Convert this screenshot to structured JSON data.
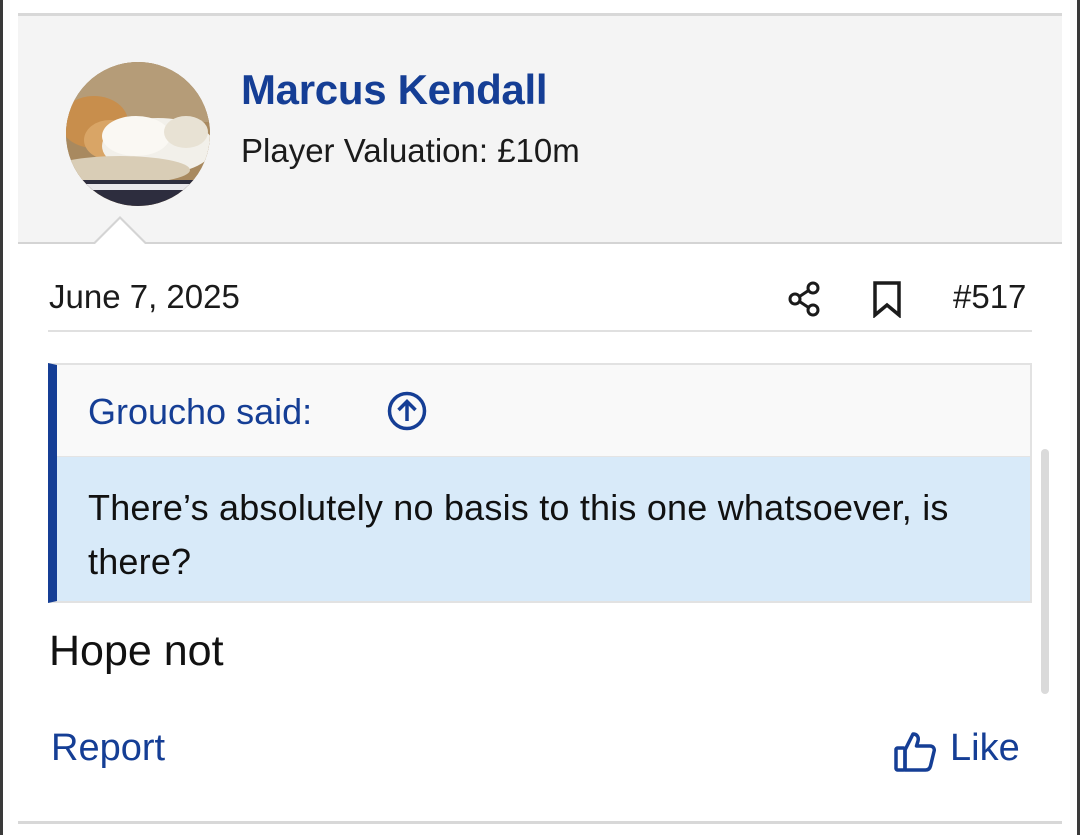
{
  "user": {
    "name": "Marcus Kendall",
    "title": "Player Valuation: £10m"
  },
  "post": {
    "date": "June 7, 2025",
    "number": "#517",
    "message": "Hope not"
  },
  "quote": {
    "author_line": "Groucho said:",
    "text": "There’s absolutely no basis to this one whatsoever, is there?"
  },
  "actions": {
    "report_label": "Report",
    "like_label": "Like"
  },
  "icons": {
    "share": "share-icon",
    "bookmark": "bookmark-icon",
    "quote_jump": "arrow-up-circle-icon",
    "like": "thumbs-up-icon"
  },
  "colors": {
    "accent": "#153e95",
    "quote_background": "#d8eaf9",
    "header_background": "#f4f4f4"
  }
}
